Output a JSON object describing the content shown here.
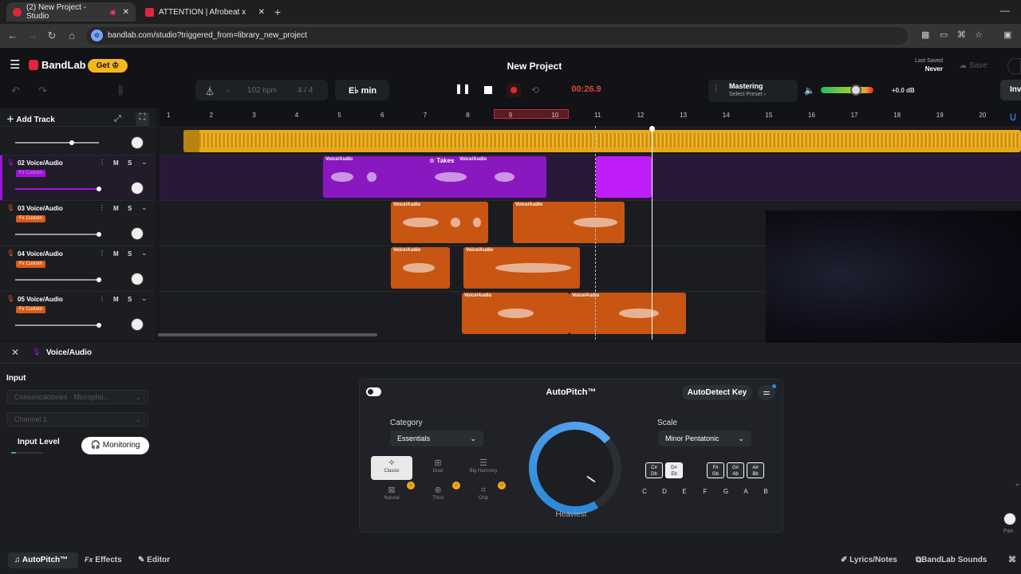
{
  "browser": {
    "tabs": [
      {
        "title": "(2) New Project - Studio",
        "active": true
      },
      {
        "title": "ATTENTION | Afrobeat x Da",
        "active": false
      }
    ],
    "url": "bandlab.com/studio?triggered_from=library_new_project"
  },
  "header": {
    "logo": "BandLab",
    "get_label": "Get",
    "project_title": "New Project",
    "last_saved_label": "Last Saved",
    "last_saved_value": "Never",
    "save_label": "Save",
    "invite_label": "Inv"
  },
  "transport": {
    "bpm": "102",
    "bpm_unit": "bpm",
    "time_signature": "4 / 4",
    "key": "E♭ min",
    "timecode": "00:26.9",
    "mastering_title": "Mastering",
    "mastering_sub": "Select Preset ›",
    "volume_db": "+0.0 dB",
    "volume_level": 0.66
  },
  "ruler": {
    "bars": [
      "1",
      "2",
      "3",
      "4",
      "5",
      "6",
      "7",
      "8",
      "9",
      "10",
      "11",
      "12",
      "13",
      "14",
      "15",
      "16",
      "17",
      "18",
      "19",
      "20"
    ]
  },
  "tracks": {
    "add_track_label": "Add Track",
    "mute": "M",
    "solo": "S",
    "rows": [
      {
        "name": "",
        "fx": ""
      },
      {
        "name": "02 Voice/Audio",
        "fx": "Fx Custom"
      },
      {
        "name": "03 Voice/Audio",
        "fx": "Fx Custom"
      },
      {
        "name": "04 Voice/Audio",
        "fx": "Fx Custom"
      },
      {
        "name": "05 Voice/Audio",
        "fx": "Fx Custom"
      }
    ]
  },
  "clips": {
    "voice_audio": "Voice/Audio",
    "takes": "Takes"
  },
  "panel": {
    "track_label": "Voice/Audio",
    "input_label": "Input",
    "input_device": "Comunicaciones - Micropho...",
    "channel": "Channel 1",
    "input_level_label": "Input Level",
    "monitoring_label": "Monitoring",
    "autopitch": {
      "title": "AutoPitch™",
      "autodetect_label": "AutoDetect Key",
      "category_label": "Category",
      "category_value": "Essentials",
      "scale_label": "Scale",
      "scale_value": "Minor Pentatonic",
      "presets": [
        "Classic",
        "Duet",
        "Big Harmony",
        "Natural",
        "Third",
        "Chip"
      ],
      "dial_label": "Heaviest",
      "key_pairs": [
        [
          "C#",
          "Db"
        ],
        [
          "D#",
          "Eb"
        ],
        [
          "F#",
          "Gb"
        ],
        [
          "G#",
          "Ab"
        ],
        [
          "A#",
          "Bb"
        ]
      ],
      "notes": [
        "C",
        "D",
        "E",
        "F",
        "G",
        "A",
        "B"
      ]
    },
    "pan_label": "Pan"
  },
  "bottom_tabs": {
    "autopitch": "AutoPitch™",
    "effects_prefix": "Fx",
    "effects": "Effects",
    "editor": "Editor",
    "lyrics": "Lyrics/Notes",
    "sounds": "BandLab Sounds"
  },
  "colors": {
    "brand_red": "#e0243d",
    "track_yellow": "#f0b322",
    "track_purple": "#a014d8",
    "track_orange": "#d95c12",
    "record_red": "#e02b2b"
  }
}
